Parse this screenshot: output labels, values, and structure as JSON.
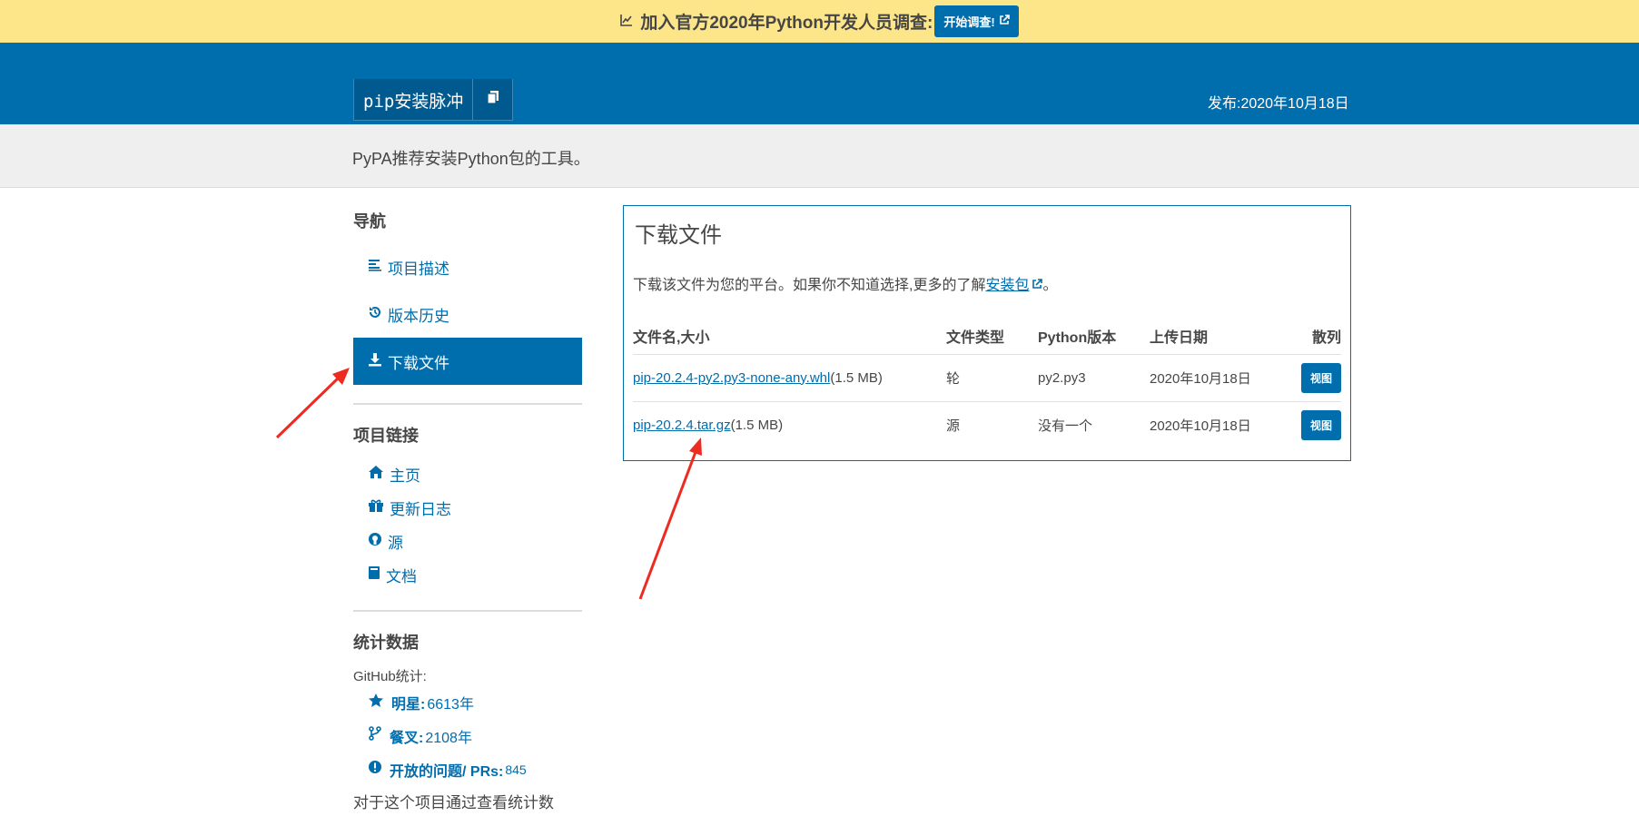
{
  "notice": {
    "text": "加入官方2020年Python开发人员调查:",
    "button_label": "开始调查!"
  },
  "header": {
    "pip_command": "pip安装脉冲",
    "release_date": "发布:2020年10月18日"
  },
  "summary": "PyPA推荐安装Python包的工具。",
  "sidebar": {
    "nav_heading": "导航",
    "nav_items": [
      {
        "label": "项目描述",
        "icon": "align-left-icon"
      },
      {
        "label": "版本历史",
        "icon": "history-icon"
      },
      {
        "label": "下载文件",
        "icon": "download-icon",
        "active": true
      }
    ],
    "links_heading": "项目链接",
    "links": [
      {
        "label": "主页",
        "icon": "home-icon"
      },
      {
        "label": "更新日志",
        "icon": "gift-icon"
      },
      {
        "label": "源",
        "icon": "github-icon"
      },
      {
        "label": "文档",
        "icon": "book-icon"
      }
    ],
    "stats_heading": "统计数据",
    "github_label": "GitHub统计:",
    "stats": [
      {
        "label": "明星:",
        "value": "6613年"
      },
      {
        "label": "餐叉:",
        "value": "2108年"
      },
      {
        "label": "开放的问题/ PRs:",
        "value": "845"
      }
    ],
    "stats_footer": "对于这个项目通过查看统计数"
  },
  "content": {
    "title": "下载文件",
    "desc_prefix": "下载该文件为您的平台。如果你不知道选择,更多的了解",
    "desc_link": "安装包",
    "desc_suffix": "。",
    "table": {
      "headers": [
        "文件名,大小",
        "文件类型",
        "Python版本",
        "上传日期",
        "散列"
      ],
      "rows": [
        {
          "filename": "pip-20.2.4-py2.py3-none-any.whl",
          "size": "(1.5 MB)",
          "type": "轮",
          "python": "py2.py3",
          "date": "2020年10月18日",
          "hash_label": "视图"
        },
        {
          "filename": "pip-20.2.4.tar.gz",
          "size": "(1.5 MB)",
          "type": "源",
          "python": "没有一个",
          "date": "2020年10月18日",
          "hash_label": "视图"
        }
      ]
    }
  },
  "colors": {
    "brand_blue": "#006dad",
    "notice_yellow": "#fde68a",
    "annotation_red": "#ee2b20"
  }
}
